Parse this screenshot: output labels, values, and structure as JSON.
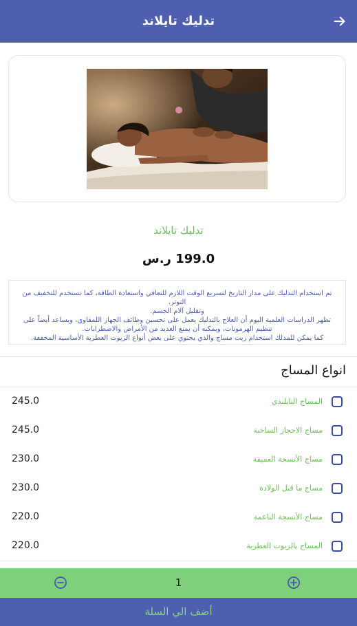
{
  "header": {
    "title": "تدليك تايلاند",
    "back_icon": "arrow-right-icon"
  },
  "product": {
    "name": "تدليك تايلاند",
    "price": "199.0 ر.س",
    "description_lines": [
      "تم استخدام التدليك على مدار التاريخ لتسريع الوقت اللازم للتعافي واستعادة الطاقة، كما تستخدم للتخفيف من التوتر،",
      "وتقليل آلام الجسم.",
      "تظهر الدراسات العلمية اليوم أن العلاج بالتدليك يعمل على تحسين وظائف الجهاز اللمفاوي، ويساعد أيضاً على",
      "تنظيم الهرمونات، ويمكنه أن يمنع العديد من الأمراض والاضطرابات.",
      "كما يمكن للمدلك استخدام زيت مساج والذي يحتوي على بعض أنواع الزيوت العطرية الأساسية المخففة."
    ]
  },
  "massage_types": {
    "title": "انواع المساج",
    "items": [
      {
        "label": "المساج التايلندي",
        "value": "245.0"
      },
      {
        "label": "مساج الاحجار الساخنة",
        "value": "245.0"
      },
      {
        "label": "مساج الأنسجة العميقة",
        "value": "230.0"
      },
      {
        "label": "مساج ما قبل الولادة",
        "value": "230.0"
      },
      {
        "label": "مساج الأنسجة الناعمة",
        "value": "220.0"
      },
      {
        "label": "المساج بالزيوت العطرية",
        "value": "220.0"
      }
    ]
  },
  "quantity": {
    "value": "1",
    "minus_icon": "minus-circle-icon",
    "plus_icon": "plus-circle-icon"
  },
  "add_to_cart": {
    "label": "أضف الي السلة"
  },
  "colors": {
    "primary": "#4f5fb0",
    "accent_green": "#6dbb5c",
    "qty_bar": "#7ed07a"
  }
}
